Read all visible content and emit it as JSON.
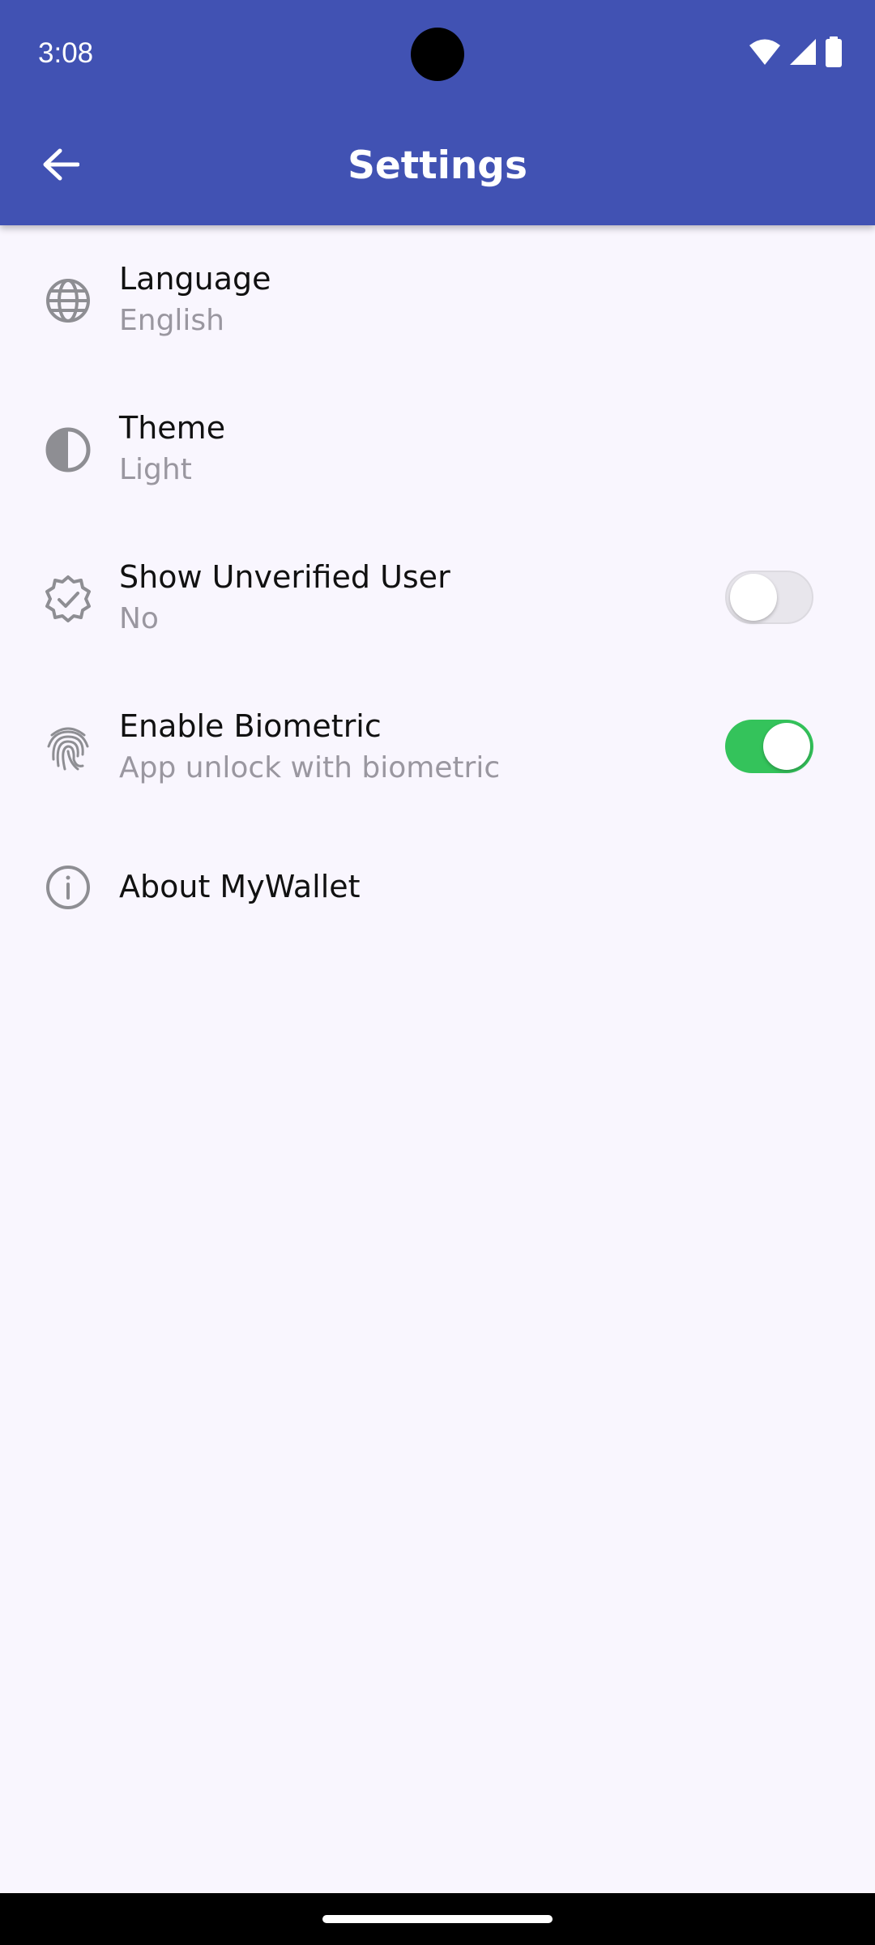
{
  "status_bar": {
    "time": "3:08",
    "icons": [
      "wifi-icon",
      "signal-icon",
      "battery-icon"
    ]
  },
  "app_bar": {
    "title": "Settings",
    "back_icon": "arrow-back-icon",
    "background": "#4152b3"
  },
  "settings": {
    "language": {
      "icon": "globe-icon",
      "title": "Language",
      "value": "English"
    },
    "theme": {
      "icon": "contrast-icon",
      "title": "Theme",
      "value": "Light"
    },
    "unverified": {
      "icon": "verified-badge-icon",
      "title": "Show Unverified User",
      "value": "No",
      "toggle_on": false
    },
    "biometric": {
      "icon": "fingerprint-icon",
      "title": "Enable Biometric",
      "value": "App unlock with biometric",
      "toggle_on": true
    },
    "about": {
      "icon": "info-icon",
      "title": "About MyWallet"
    }
  },
  "colors": {
    "accent": "#4152b3",
    "toggle_on": "#34c35b",
    "background": "#f9f6fe"
  }
}
